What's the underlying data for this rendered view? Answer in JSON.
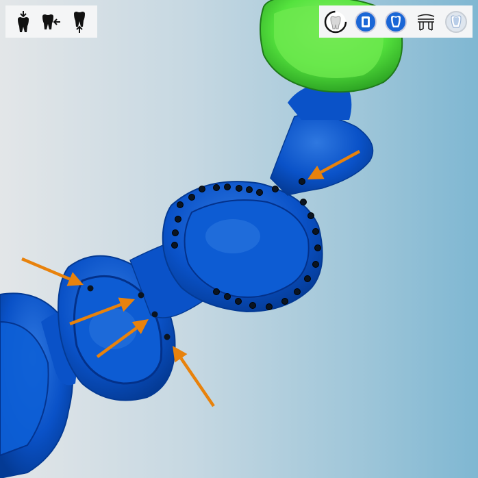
{
  "colors": {
    "prep_blue": "#0a52c8",
    "prep_blue_dark": "#043a94",
    "prep_highlight": "#3d85e6",
    "antagonist_green": "#55e33e",
    "antagonist_green_dark": "#2ea624",
    "arrow_orange": "#e8820c",
    "margin_point": "#0b1420",
    "toolbar_bg": "#f4f5f6",
    "icon_dark": "#111111",
    "icon_blue": "#1a66d6"
  },
  "toolbar_left": [
    {
      "icon": "tooth-insertion-top-icon"
    },
    {
      "icon": "tooth-insertion-side-icon"
    },
    {
      "icon": "tooth-insertion-bottom-icon"
    }
  ],
  "toolbar_right": [
    {
      "icon": "tooth-outline-circle-icon",
      "state": "active"
    },
    {
      "icon": "tooth-inlay-blue-icon"
    },
    {
      "icon": "tooth-crown-blue-icon"
    },
    {
      "icon": "bridge-frame-icon"
    },
    {
      "icon": "tooth-ghost-icon",
      "state": "disabled"
    }
  ]
}
